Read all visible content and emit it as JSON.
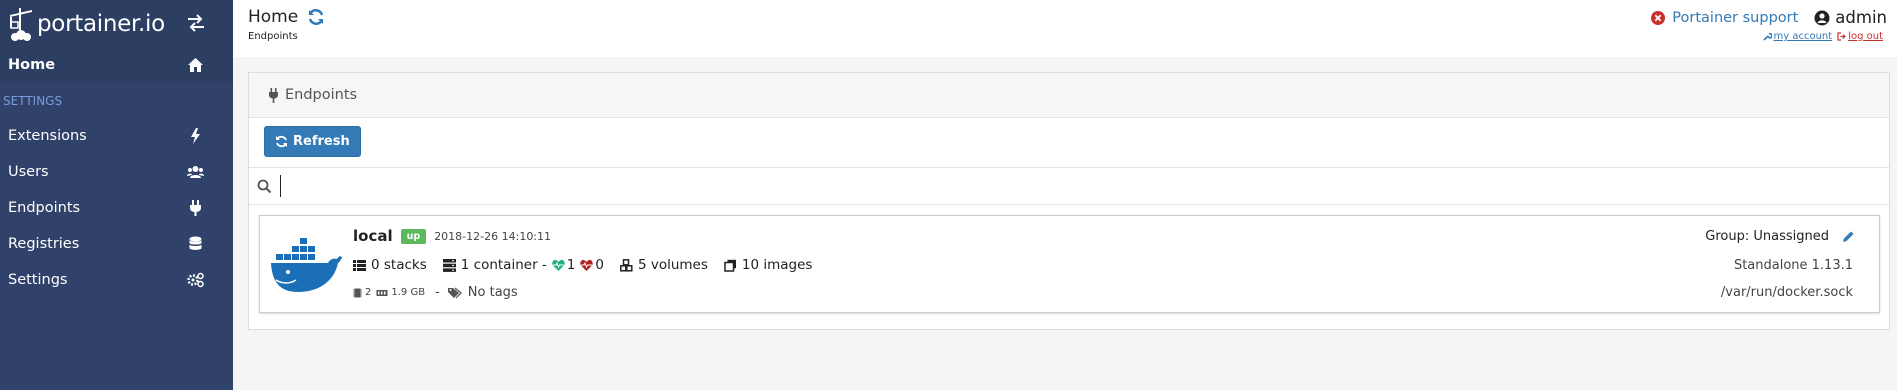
{
  "brand": {
    "name": "portainer.io"
  },
  "sidebar": {
    "items": [
      {
        "label": "Home",
        "icon": "home-icon",
        "active": true
      },
      {
        "section": "SETTINGS"
      },
      {
        "label": "Extensions",
        "icon": "bolt-icon"
      },
      {
        "label": "Users",
        "icon": "users-icon"
      },
      {
        "label": "Endpoints",
        "icon": "plug-icon"
      },
      {
        "label": "Registries",
        "icon": "database-icon"
      },
      {
        "label": "Settings",
        "icon": "cogs-icon"
      }
    ]
  },
  "header": {
    "title": "Home",
    "breadcrumb": "Endpoints",
    "support_label": "Portainer support",
    "user": "admin",
    "my_account": "my account",
    "log_out": "log out"
  },
  "widget": {
    "title": "Endpoints",
    "refresh_label": "Refresh",
    "search_placeholder": ""
  },
  "endpoint": {
    "name": "local",
    "status": "up",
    "date": "2018-12-26 14:10:11",
    "stacks": "0 stacks",
    "containers": "1 container -",
    "healthy": "1",
    "unhealthy": "0",
    "volumes": "5 volumes",
    "images": "10 images",
    "cpu": "2",
    "memory": "1.9 GB",
    "separator": "-",
    "tags": "No tags",
    "group": "Group: Unassigned",
    "type": "Standalone 1.13.1",
    "url": "/var/run/docker.sock"
  },
  "colors": {
    "sidebar": "#30426a",
    "sidebar_active": "#2d3e63",
    "settings_section": "#7a9bd9",
    "primary": "#337ab7",
    "up_badge": "#5cb85c",
    "heart_healthy": "#23ae89",
    "heart_unhealthy": "#ae2323",
    "logout": "#c9302c"
  }
}
